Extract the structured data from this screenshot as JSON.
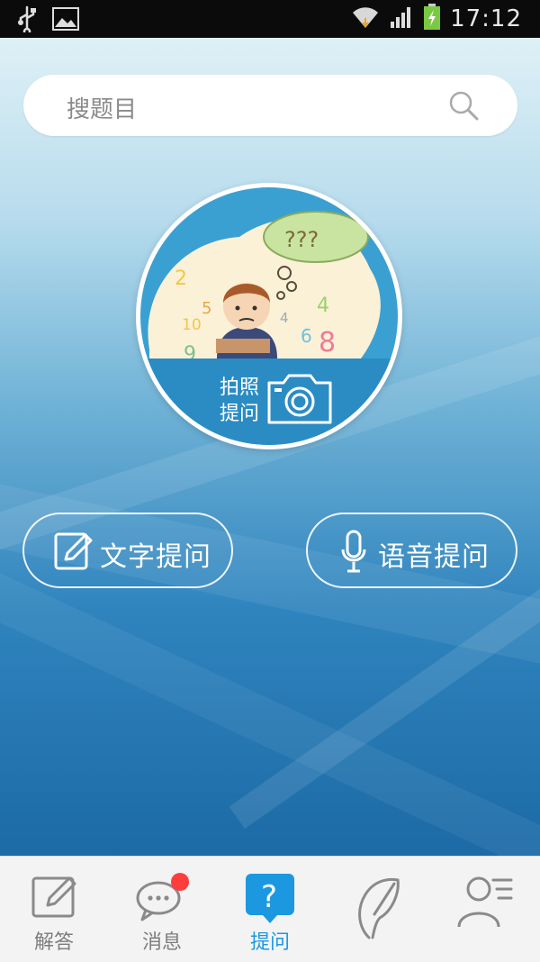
{
  "status_bar": {
    "time": "17:12"
  },
  "search": {
    "placeholder": "搜题目"
  },
  "photo_question": {
    "label_line1": "拍照",
    "label_line2": "提问",
    "illustration_text": "???",
    "numbers": [
      "2",
      "5",
      "10",
      "4",
      "4",
      "6",
      "8",
      "9"
    ]
  },
  "actions": {
    "text_question": "文字提问",
    "voice_question": "语音提问"
  },
  "tabs": [
    {
      "label": "解答",
      "icon": "pencil-note-icon",
      "active": false
    },
    {
      "label": "消息",
      "icon": "chat-bubble-icon",
      "active": false,
      "badge": true
    },
    {
      "label": "提问",
      "icon": "question-icon",
      "active": true
    },
    {
      "label": "",
      "icon": "quill-icon",
      "active": false
    },
    {
      "label": "",
      "icon": "profile-list-icon",
      "active": false
    }
  ],
  "colors": {
    "accent": "#1b98e0",
    "badge": "#ff3d3d",
    "photo_bg": "#3aa0d2"
  }
}
